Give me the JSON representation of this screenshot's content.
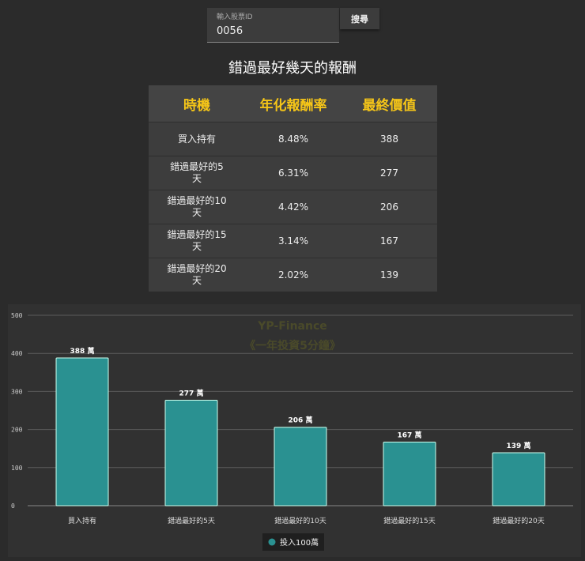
{
  "search": {
    "label": "輸入股票ID",
    "value": "0056",
    "button": "搜尋"
  },
  "title": "錯過最好幾天的報酬",
  "table": {
    "headers": [
      "時機",
      "年化報酬率",
      "最終價值"
    ],
    "rows": [
      [
        "買入持有",
        "8.48%",
        "388"
      ],
      [
        "錯過最好的5天",
        "6.31%",
        "277"
      ],
      [
        "錯過最好的10天",
        "4.42%",
        "206"
      ],
      [
        "錯過最好的15天",
        "3.14%",
        "167"
      ],
      [
        "錯過最好的20天",
        "2.02%",
        "139"
      ]
    ]
  },
  "chart_data": {
    "type": "bar",
    "categories": [
      "買入持有",
      "錯過最好的5天",
      "錯過最好的10天",
      "錯過最好的15天",
      "錯過最好的20天"
    ],
    "series": [
      {
        "name": "投入100萬",
        "values": [
          388,
          277,
          206,
          167,
          139
        ],
        "color": "#2a9191"
      }
    ],
    "data_labels": [
      "388 萬",
      "277 萬",
      "206 萬",
      "167 萬",
      "139 萬"
    ],
    "yticks": [
      0,
      100,
      200,
      300,
      400,
      500
    ],
    "ylim": [
      0,
      500
    ],
    "grid": true,
    "legend": "bottom",
    "watermark": [
      "YP-Finance",
      "《一年投資5分鐘》"
    ]
  }
}
